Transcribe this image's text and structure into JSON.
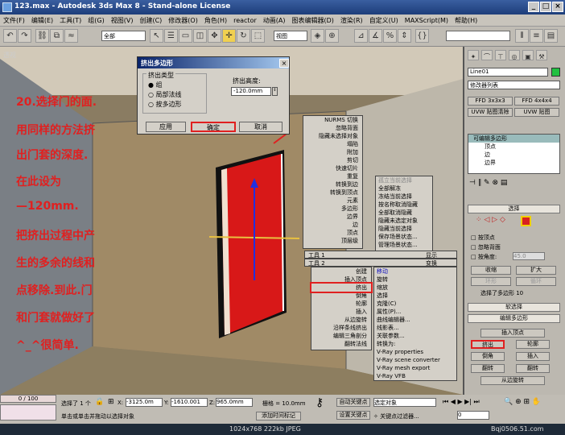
{
  "window": {
    "title": "123.max - Autodesk 3ds Max 8  - Stand-alone License",
    "controls": [
      "_",
      "□",
      "×"
    ]
  },
  "menu": [
    "文件(F)",
    "编辑(E)",
    "工具(T)",
    "组(G)",
    "视图(V)",
    "创建(C)",
    "修改器(O)",
    "角色(H)",
    "reactor",
    "动画(A)",
    "图表编辑器(D)",
    "渲染(R)",
    "自定义(U)",
    "MAXScript(M)",
    "帮助(H)"
  ],
  "toolbar": {
    "selection_filter": "全部",
    "ref_coord": "视图"
  },
  "viewport": {
    "label": "透视"
  },
  "tutorial": {
    "lines": [
      "20.选择门的面.",
      "用同样的方法挤",
      "出门套的深度.",
      "在此设为",
      "—120mm.",
      "把挤出过程中产",
      "生的多余的线和",
      "点移除.到此.门",
      "和门套就做好了",
      "^_^很简单."
    ]
  },
  "dialog": {
    "title": "挤出多边形",
    "group_label": "挤出类型",
    "options": [
      "组",
      "局部法线",
      "按多边形"
    ],
    "selected_option": 0,
    "height_label": "挤出高度:",
    "height_value": "-120.0mm",
    "apply": "应用",
    "ok": "确定",
    "cancel": "取消"
  },
  "quad_top_left": [
    "NURMS 切换",
    "忽略背面",
    "隐藏未选择对象",
    "塌陷",
    "附加",
    "剪切",
    "快速切片",
    "重复",
    "转换到边",
    "转换到顶点",
    "元素",
    "多边形",
    "边界",
    "边",
    "顶点",
    "顶层级"
  ],
  "quad_top_right": [
    "孤立当前选择",
    "全部解冻",
    "冻结当前选择",
    "按名称取消隐藏",
    "全部取消隐藏",
    "隐藏未选定对象",
    "隐藏当前选择",
    "保存场景状态...",
    "管理场景状态..."
  ],
  "quad_headers": {
    "tools1": "工具 1",
    "display": "显示",
    "tools2": "工具 2",
    "transform": "变换"
  },
  "quad_bottom_left": [
    "创建",
    "插入顶点",
    "挤出",
    "倒角",
    "轮廓",
    "插入",
    "从边旋转",
    "沿样条线挤出",
    "编辑三角剖分",
    "翻转法线"
  ],
  "quad_bottom_right": [
    "移动",
    "旋转",
    "缩放",
    "选择",
    "克隆(C)",
    "属性(P)...",
    "曲线编辑器...",
    "线影表...",
    "关联参数...",
    "转换为:",
    "V-Ray properties",
    "V-Ray scene converter",
    "V-Ray mesh export",
    "V-Ray VFB"
  ],
  "command_panel": {
    "object_name": "Line01",
    "modifier_list": "修改器列表",
    "mod_buttons": [
      "FFD 3x3x3",
      "FFD 4x4x4",
      "UVW 贴图清除",
      "UVW 贴图"
    ],
    "stack": [
      "可编辑多边形",
      "顶点",
      "边",
      "边界"
    ],
    "selection_title": "选择",
    "by_vertex": "按顶点",
    "ignore_back": "忽略背面",
    "by_angle": "按角度:",
    "angle_value": "45.0",
    "shrink": "收缩",
    "grow": "扩大",
    "ring": "环形",
    "loop": "循环",
    "selected_info": "选择了多边形 10",
    "soft_sel": "软选择",
    "edit_poly": "编辑多边形",
    "insert_vertex": "插入顶点",
    "extrude": "挤出",
    "outline": "轮廓",
    "bevel": "倒角",
    "inset": "插入",
    "flip": "翻转",
    "flip2": "翻转",
    "hinge": "从边旋转"
  },
  "status": {
    "frame": "0 / 100",
    "selection": "选择了 1 个",
    "x": "-3125.0m",
    "y": "-1610.001",
    "z": "965.0mm",
    "grid": "栅格 = 10.0mm",
    "autokey": "自动关键点",
    "keyfilter": "选定对象",
    "setkey": "设置关键点",
    "keyfilters": "关键点过滤器...",
    "prompt": "单击或单击并拖动以选择对象",
    "addtime": "添加时间标记",
    "frame_num": "0",
    "watermark_info": "1024x768  222kb  JPEG",
    "watermark_site": "Bqj0506.51.com"
  }
}
